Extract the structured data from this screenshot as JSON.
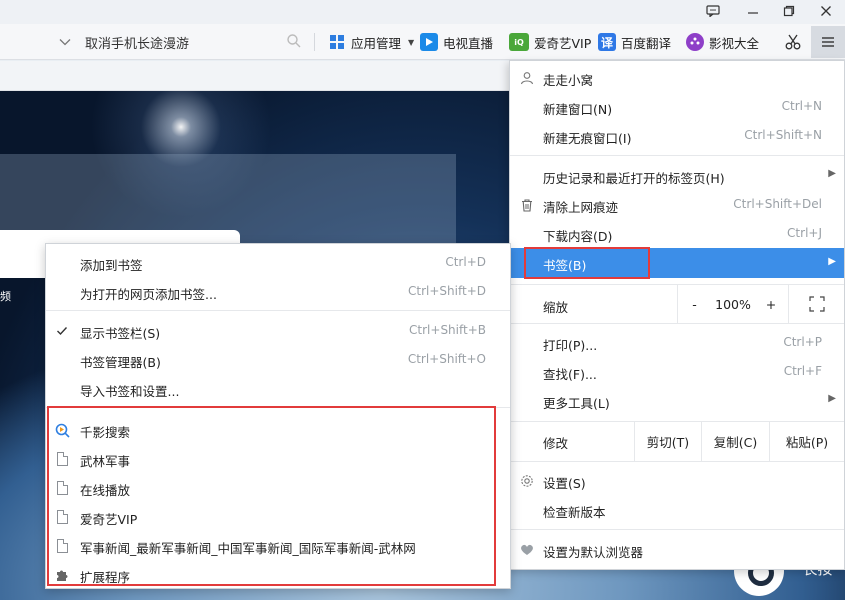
{
  "titlebar": {
    "buttons": [
      "feedback-icon",
      "minimize-icon",
      "restore-icon",
      "close-icon"
    ]
  },
  "toolbar": {
    "address_text": "取消手机长途漫游",
    "items": [
      {
        "label": "应用管理",
        "icon": "apps-grid-icon",
        "color": "#2d7de0"
      },
      {
        "label": "电视直播",
        "icon": "tv-play-icon",
        "color": "#1b8ae8"
      },
      {
        "label": "爱奇艺VIP",
        "icon": "iqiyi-icon",
        "color": "#4aa73a"
      },
      {
        "label": "百度翻译",
        "icon": "translate-icon",
        "color": "#2f78e6"
      },
      {
        "label": "影视大全",
        "icon": "film-reel-icon",
        "color": "#8e3fc8"
      }
    ]
  },
  "page": {
    "hot_label": "频",
    "corner_text": "长按"
  },
  "menu": {
    "user": "走走小窝",
    "new_window": "新建窗口(N)",
    "new_window_sc": "Ctrl+N",
    "new_incognito": "新建无痕窗口(I)",
    "new_incognito_sc": "Ctrl+Shift+N",
    "history": "历史记录和最近打开的标签页(H)",
    "clear": "清除上网痕迹",
    "clear_sc": "Ctrl+Shift+Del",
    "downloads": "下载内容(D)",
    "downloads_sc": "Ctrl+J",
    "bookmarks": "书签(B)",
    "zoom_label": "缩放",
    "zoom_minus": "-",
    "zoom_value": "100%",
    "zoom_plus": "+",
    "print": "打印(P)...",
    "print_sc": "Ctrl+P",
    "find": "查找(F)...",
    "find_sc": "Ctrl+F",
    "more_tools": "更多工具(L)",
    "edit_label": "修改",
    "cut": "剪切(T)",
    "copy": "复制(C)",
    "paste": "粘贴(P)",
    "settings": "设置(S)",
    "check_update": "检查新版本",
    "set_default": "设置为默认浏览器",
    "highlight_color": "#3c8ee8"
  },
  "submenu": {
    "add_bookmark": "添加到书签",
    "add_bookmark_sc": "Ctrl+D",
    "bookmark_open_pages": "为打开的网页添加书签...",
    "bookmark_open_pages_sc": "Ctrl+Shift+D",
    "show_bar": "显示书签栏(S)",
    "show_bar_sc": "Ctrl+Shift+B",
    "manager": "书签管理器(B)",
    "manager_sc": "Ctrl+Shift+O",
    "import": "导入书签和设置...",
    "bookmarks": [
      {
        "label": "千影搜索",
        "icon": "search-play-icon"
      },
      {
        "label": "武林军事",
        "icon": "page-icon"
      },
      {
        "label": "在线播放",
        "icon": "page-icon"
      },
      {
        "label": "爱奇艺VIP",
        "icon": "page-icon"
      },
      {
        "label": "军事新闻_最新军事新闻_中国军事新闻_国际军事新闻-武林网",
        "icon": "page-icon"
      },
      {
        "label": "扩展程序",
        "icon": "puzzle-icon"
      }
    ],
    "annotation_color": "#e23b3b"
  }
}
